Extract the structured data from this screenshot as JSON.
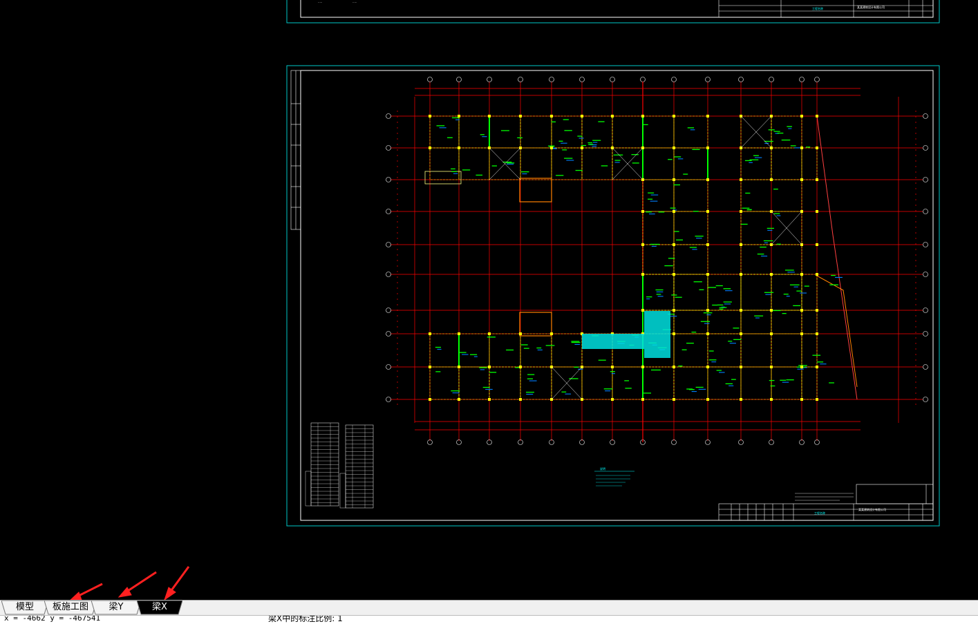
{
  "window": {
    "background": "#000000"
  },
  "drawing": {
    "frame_color": "#00ffff",
    "border_color": "#ffffff",
    "grid_color": "#ff0000",
    "beam_color": "#ffff00",
    "label_color": "#00ff00",
    "dim_color": "#0080ff",
    "fill_color": "#00ffff",
    "title_company": "某某建筑设计有限公司",
    "title_project": "工程名称",
    "notes_title": "说明",
    "annotation_color": "#ff0000"
  },
  "tabs": [
    {
      "label": "模型",
      "active": false
    },
    {
      "label": "板施工图",
      "active": false
    },
    {
      "label": "梁Y",
      "active": false
    },
    {
      "label": "梁X",
      "active": true
    }
  ],
  "status": {
    "coords": "x = -4662  y = -467541",
    "prompt": "梁X中的标注比例: 1"
  }
}
